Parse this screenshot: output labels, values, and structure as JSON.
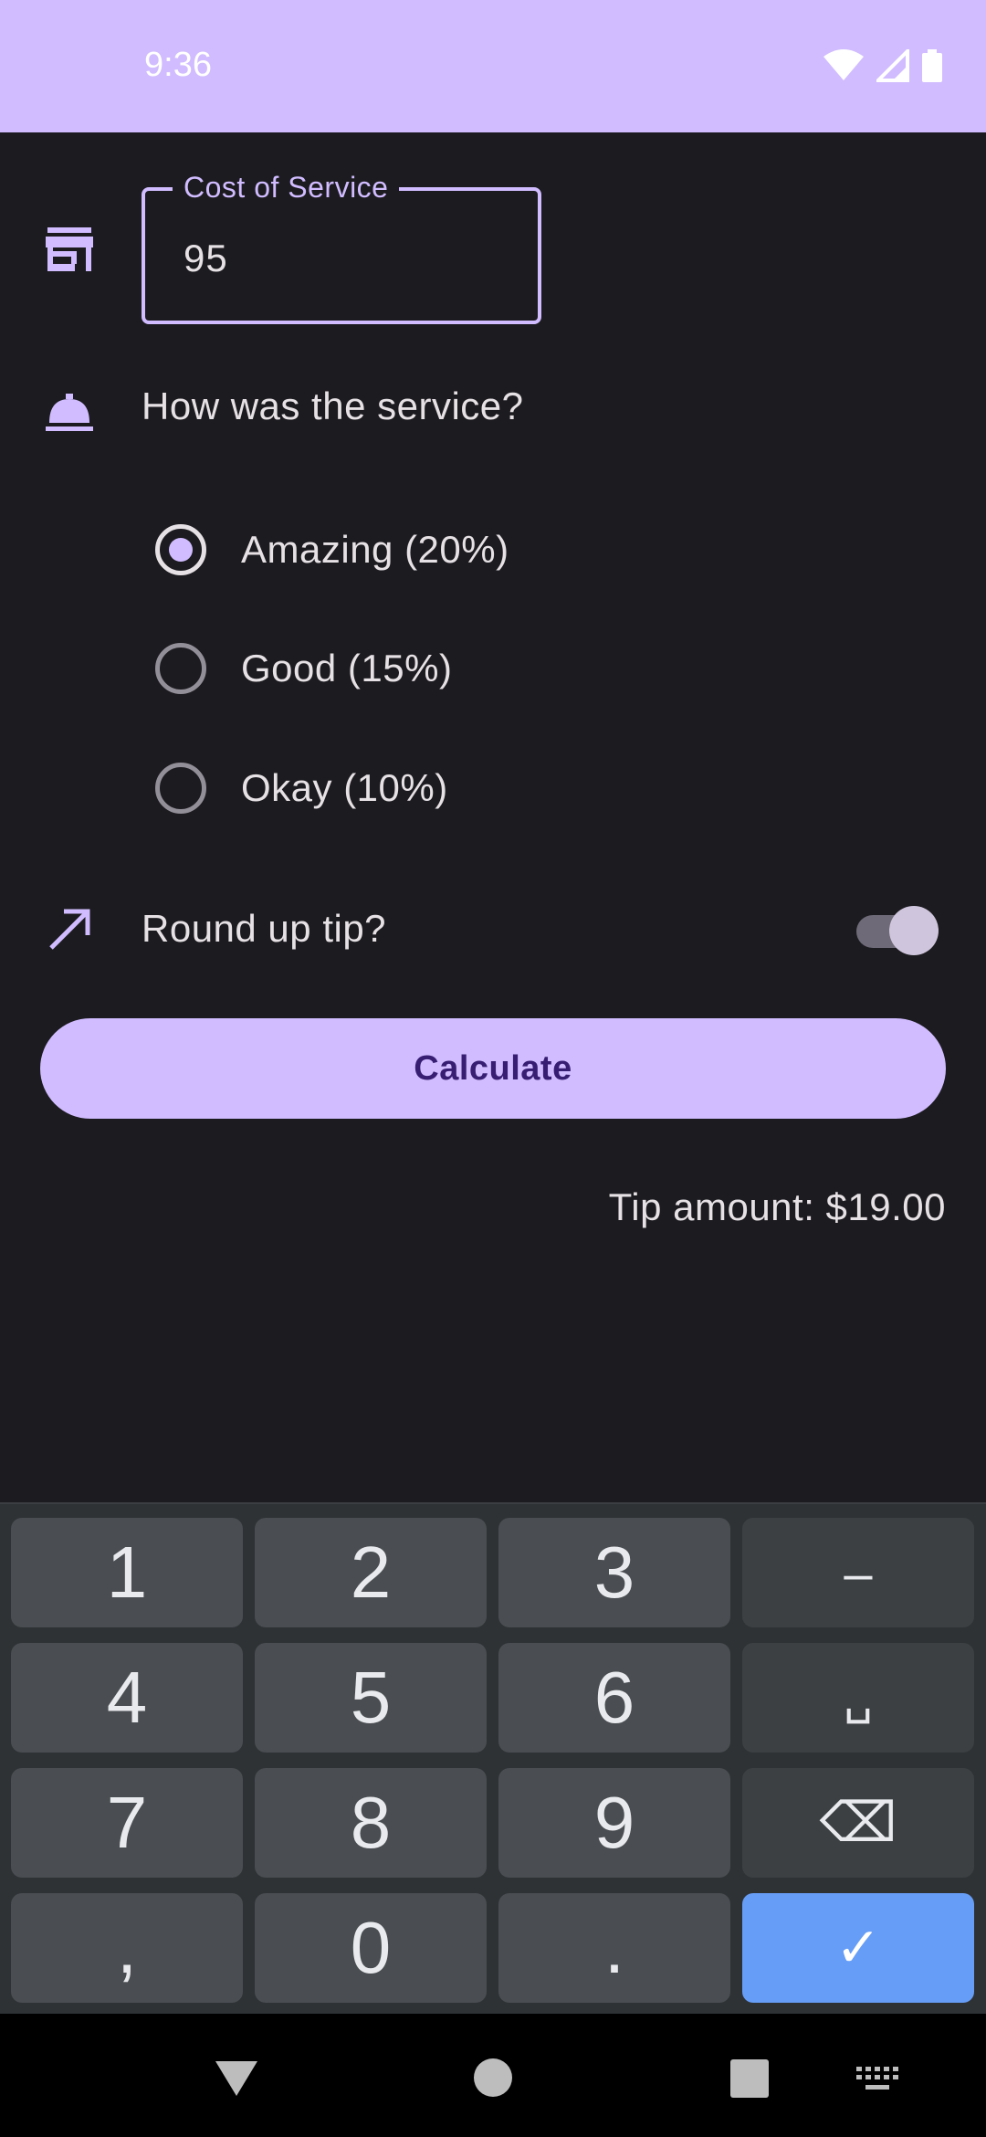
{
  "status_bar": {
    "time": "9:36",
    "icons": [
      "wifi-icon",
      "signal-icon",
      "battery-icon"
    ],
    "background": "#d0bcff"
  },
  "form": {
    "cost_label": "Cost of Service",
    "cost_value": "95",
    "question": "How was the service?",
    "options": [
      {
        "label": "Amazing (20%)",
        "selected": true
      },
      {
        "label": "Good (15%)",
        "selected": false
      },
      {
        "label": "Okay (10%)",
        "selected": false
      }
    ],
    "round_up_label": "Round up tip?",
    "round_up_on": true,
    "calculate_label": "Calculate",
    "tip_amount": "Tip amount: $19.00",
    "accent": "#d0bcff"
  },
  "keyboard": {
    "keys": [
      "1",
      "2",
      "3",
      "–",
      "4",
      "5",
      "6",
      "␣",
      "7",
      "8",
      "9",
      "⌫",
      ",",
      "0",
      ".",
      "✓"
    ],
    "done_color": "#669df6"
  },
  "nav_bar": {
    "icons": [
      "back-icon",
      "home-icon",
      "recents-icon",
      "keyboard-icon"
    ]
  }
}
